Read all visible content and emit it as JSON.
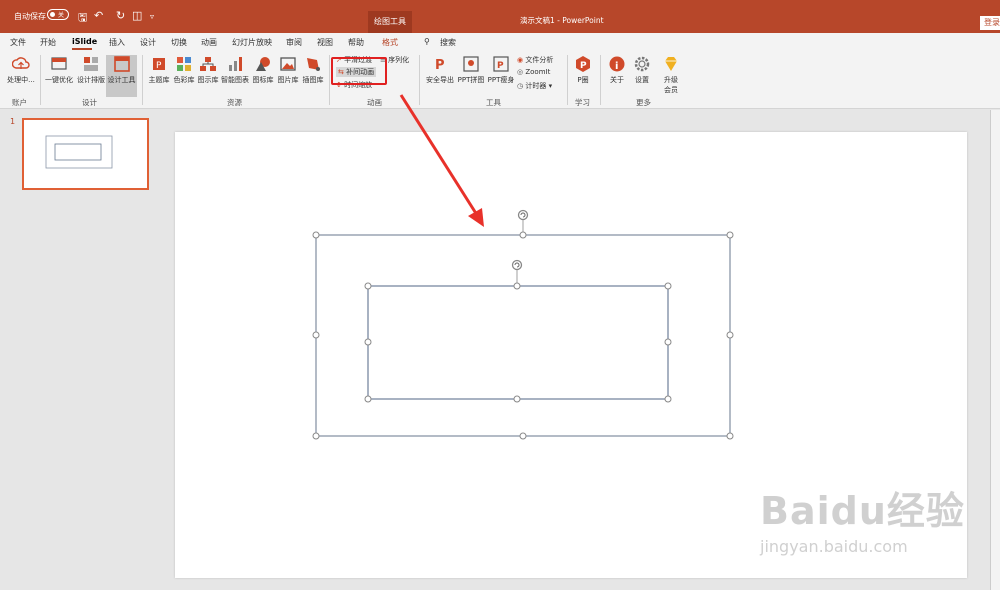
{
  "titlebar": {
    "autosave_label": "自动保存",
    "autosave_state": "关",
    "context_tab": "绘图工具",
    "document_title": "演示文稿1 - PowerPoint",
    "login": "登录"
  },
  "menu": {
    "items": [
      "文件",
      "开始",
      "iSlide",
      "插入",
      "设计",
      "切换",
      "动画",
      "幻灯片放映",
      "审阅",
      "视图",
      "帮助",
      "格式"
    ],
    "search": "搜索"
  },
  "ribbon": {
    "account": {
      "btn": "处理中...",
      "label": "账户"
    },
    "design": {
      "btns": [
        "一键优化",
        "设计排版",
        "设计工具"
      ],
      "label": "设计"
    },
    "resources": {
      "btns": [
        "主题库",
        "色彩库",
        "图示库",
        "智能图表",
        "图标库",
        "图片库",
        "插图库"
      ],
      "label": "资源"
    },
    "animation": {
      "items": [
        "平滑过渡",
        "补间动画",
        "时间缩放",
        "序列化"
      ],
      "label": "动画"
    },
    "tools": {
      "btns": [
        "安全导出",
        "PPT拼图",
        "PPT瘦身"
      ],
      "items": [
        "文件分析",
        "ZoomIt",
        "计时器"
      ],
      "label": "工具"
    },
    "learn": {
      "btn": "P圈",
      "label": "学习"
    },
    "more": {
      "btns": [
        "关于",
        "设置",
        "升级",
        "会员"
      ],
      "label": "更多"
    }
  },
  "slides": {
    "current": "1"
  },
  "watermark": {
    "line1": "Baidu经验",
    "line2": "jingyan.baidu.com"
  },
  "colors": {
    "accent": "#b7472a",
    "highlight": "#e02020",
    "arrow": "#e8312a"
  }
}
